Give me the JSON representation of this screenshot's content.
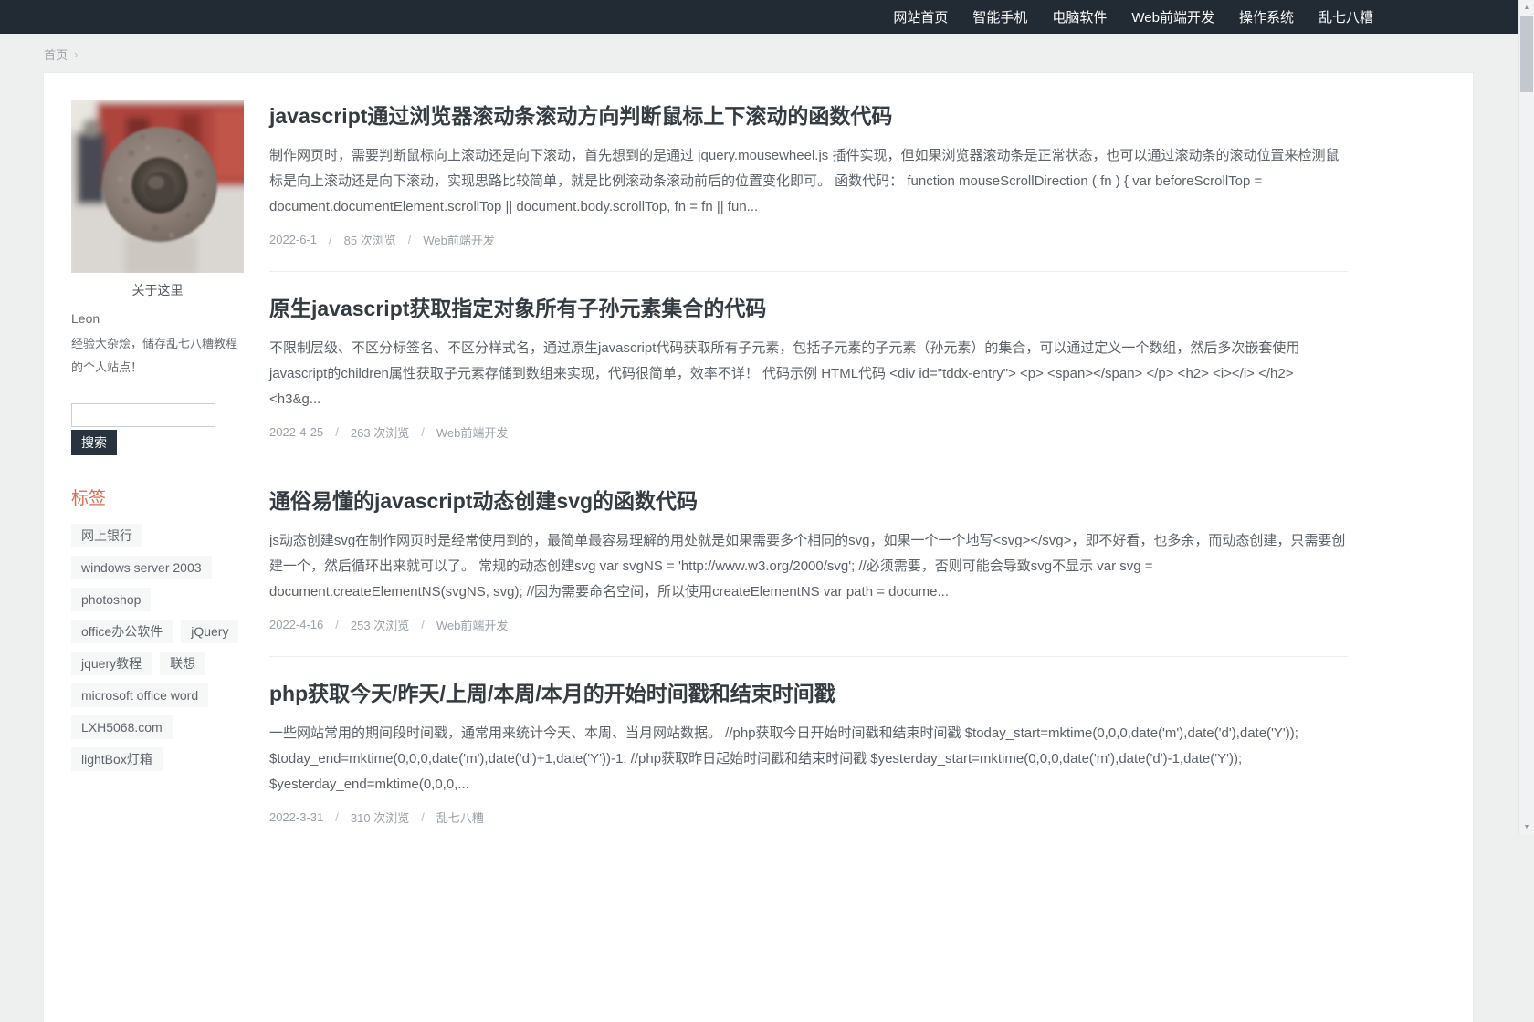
{
  "nav": {
    "items": [
      {
        "label": "网站首页"
      },
      {
        "label": "智能手机"
      },
      {
        "label": "电脑软件"
      },
      {
        "label": "Web前端开发"
      },
      {
        "label": "操作系统"
      },
      {
        "label": "乱七八糟"
      }
    ]
  },
  "breadcrumb": {
    "home": "首页",
    "separator": "›"
  },
  "sidebar": {
    "about": {
      "caption": "关于这里",
      "name": "Leon",
      "description": "经验大杂烩，储存乱七八糟教程的个人站点！"
    },
    "search": {
      "value": "",
      "button_label": "搜索"
    },
    "tags": {
      "title": "标签",
      "items": [
        "网上银行",
        "windows server 2003",
        "photoshop",
        "office办公软件",
        "jQuery",
        "jquery教程",
        "联想",
        "microsoft office word",
        "LXH5068.com",
        "lightBox灯箱"
      ]
    }
  },
  "articles": [
    {
      "title": "javascript通过浏览器滚动条滚动方向判断鼠标上下滚动的函数代码",
      "excerpt": "制作网页时，需要判断鼠标向上滚动还是向下滚动，首先想到的是通过 jquery.mousewheel.js 插件实现，但如果浏览器滚动条是正常状态，也可以通过滚动条的滚动位置来检测鼠标是向上滚动还是向下滚动，实现思路比较简单，就是比例滚动条滚动前后的位置变化即可。 函数代码： function mouseScrollDirection ( fn ) { var beforeScrollTop = document.documentElement.scrollTop || document.body.scrollTop, fn = fn || fun...",
      "date": "2022-6-1",
      "views": "85 次浏览",
      "category": "Web前端开发"
    },
    {
      "title": "原生javascript获取指定对象所有子孙元素集合的代码",
      "excerpt": "不限制层级、不区分标签名、不区分样式名，通过原生javascript代码获取所有子元素，包括子元素的子元素（孙元素）的集合，可以通过定义一个数组，然后多次嵌套使用 javascript的children属性获取子元素存储到数组来实现，代码很简单，效率不详！ 代码示例 HTML代码 <div id=\"tddx-entry\"> <p> <span></span> </p> <h2> <i></i> </h2> <h3&g...",
      "date": "2022-4-25",
      "views": "263 次浏览",
      "category": "Web前端开发"
    },
    {
      "title": "通俗易懂的javascript动态创建svg的函数代码",
      "excerpt": "js动态创建svg在制作网页时是经常使用到的，最简单最容易理解的用处就是如果需要多个相同的svg，如果一个一个地写<svg></svg>，即不好看，也多余，而动态创建，只需要创建一个，然后循环出来就可以了。 常规的动态创建svg var svgNS = 'http://www.w3.org/2000/svg'; //必须需要，否则可能会导致svg不显示 var svg = document.createElementNS(svgNS, svg); //因为需要命名空间，所以使用createElementNS var path = docume...",
      "date": "2022-4-16",
      "views": "253 次浏览",
      "category": "Web前端开发"
    },
    {
      "title": "php获取今天/昨天/上周/本周/本月的开始时间戳和结束时间戳",
      "excerpt": "一些网站常用的期间段时间戳，通常用来统计今天、本周、当月网站数据。 //php获取今日开始时间戳和结束时间戳 $today_start=mktime(0,0,0,date('m'),date('d'),date('Y')); $today_end=mktime(0,0,0,date('m'),date('d')+1,date('Y'))-1; //php获取昨日起始时间戳和结束时间戳 $yesterday_start=mktime(0,0,0,date('m'),date('d')-1,date('Y')); $yesterday_end=mktime(0,0,0,...",
      "date": "2022-3-31",
      "views": "310 次浏览",
      "category": "乱七八糟"
    }
  ],
  "ui": {
    "meta_separator": "/",
    "scroll_up": "▲",
    "scroll_down": "▼"
  },
  "colors": {
    "navbar_bg": "#222a34",
    "page_bg": "#eef0f0",
    "tags_title_accent": "#df6c4f",
    "search_button_bg": "#29333d"
  }
}
